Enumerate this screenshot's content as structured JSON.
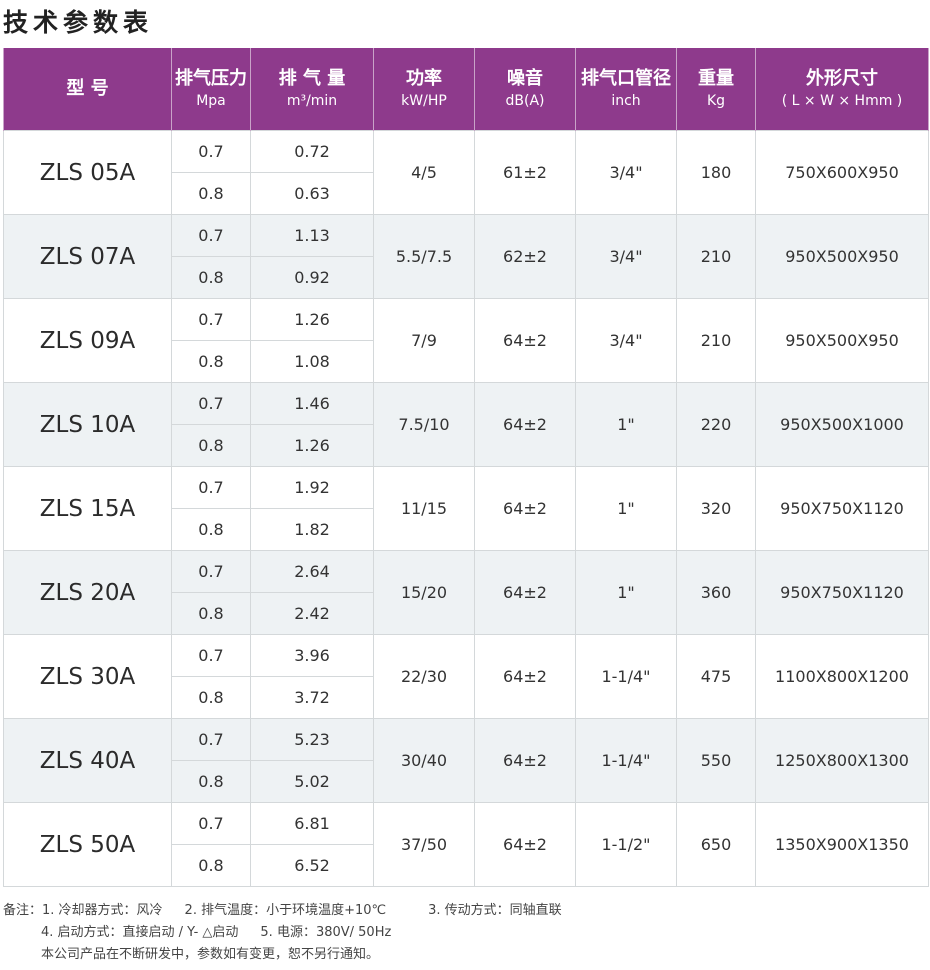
{
  "title": "技术参数表",
  "headers": [
    {
      "l1": "型  号",
      "l2": ""
    },
    {
      "l1": "排气压力",
      "l2": "Mpa"
    },
    {
      "l1": "排 气 量",
      "l2": "m³/min"
    },
    {
      "l1": "功率",
      "l2": "kW/HP"
    },
    {
      "l1": "噪音",
      "l2": "dB(A)"
    },
    {
      "l1": "排气口管径",
      "l2": "inch"
    },
    {
      "l1": "重量",
      "l2": "Kg"
    },
    {
      "l1": "外形尺寸",
      "l2": "( L × W × Hmm )"
    }
  ],
  "rows": [
    {
      "model": "ZLS 05A",
      "p1": "0.7",
      "q1": "0.72",
      "p2": "0.8",
      "q2": "0.63",
      "power": "4/5",
      "noise": "61±2",
      "pipe": "3/4\"",
      "weight": "180",
      "size": "750X600X950"
    },
    {
      "model": "ZLS 07A",
      "p1": "0.7",
      "q1": "1.13",
      "p2": "0.8",
      "q2": "0.92",
      "power": "5.5/7.5",
      "noise": "62±2",
      "pipe": "3/4\"",
      "weight": "210",
      "size": "950X500X950"
    },
    {
      "model": "ZLS 09A",
      "p1": "0.7",
      "q1": "1.26",
      "p2": "0.8",
      "q2": "1.08",
      "power": "7/9",
      "noise": "64±2",
      "pipe": "3/4\"",
      "weight": "210",
      "size": "950X500X950"
    },
    {
      "model": "ZLS 10A",
      "p1": "0.7",
      "q1": "1.46",
      "p2": "0.8",
      "q2": "1.26",
      "power": "7.5/10",
      "noise": "64±2",
      "pipe": "1\"",
      "weight": "220",
      "size": "950X500X1000"
    },
    {
      "model": "ZLS 15A",
      "p1": "0.7",
      "q1": "1.92",
      "p2": "0.8",
      "q2": "1.82",
      "power": "11/15",
      "noise": "64±2",
      "pipe": "1\"",
      "weight": "320",
      "size": "950X750X1120"
    },
    {
      "model": "ZLS 20A",
      "p1": "0.7",
      "q1": "2.64",
      "p2": "0.8",
      "q2": "2.42",
      "power": "15/20",
      "noise": "64±2",
      "pipe": "1\"",
      "weight": "360",
      "size": "950X750X1120"
    },
    {
      "model": "ZLS 30A",
      "p1": "0.7",
      "q1": "3.96",
      "p2": "0.8",
      "q2": "3.72",
      "power": "22/30",
      "noise": "64±2",
      "pipe": "1-1/4\"",
      "weight": "475",
      "size": "1100X800X1200"
    },
    {
      "model": "ZLS 40A",
      "p1": "0.7",
      "q1": "5.23",
      "p2": "0.8",
      "q2": "5.02",
      "power": "30/40",
      "noise": "64±2",
      "pipe": "1-1/4\"",
      "weight": "550",
      "size": "1250X800X1300"
    },
    {
      "model": "ZLS 50A",
      "p1": "0.7",
      "q1": "6.81",
      "p2": "0.8",
      "q2": "6.52",
      "power": "37/50",
      "noise": "64±2",
      "pipe": "1-1/2\"",
      "weight": "650",
      "size": "1350X900X1350"
    }
  ],
  "notes": {
    "n1": "备注：1. 冷却器方式：风冷",
    "n2": "2. 排气温度：小于环境温度+10℃",
    "n3": "3. 传动方式：同轴直联",
    "n4": "4. 启动方式：直接启动 / Y- △启动",
    "n5": "5. 电源：380V/ 50Hz",
    "n6": "本公司产品在不断研发中，参数如有变更，恕不另行通知。"
  },
  "colors": {
    "header_bg": "#8e3a8c",
    "row_shade": "#eef2f4",
    "border": "#d4d8da"
  }
}
